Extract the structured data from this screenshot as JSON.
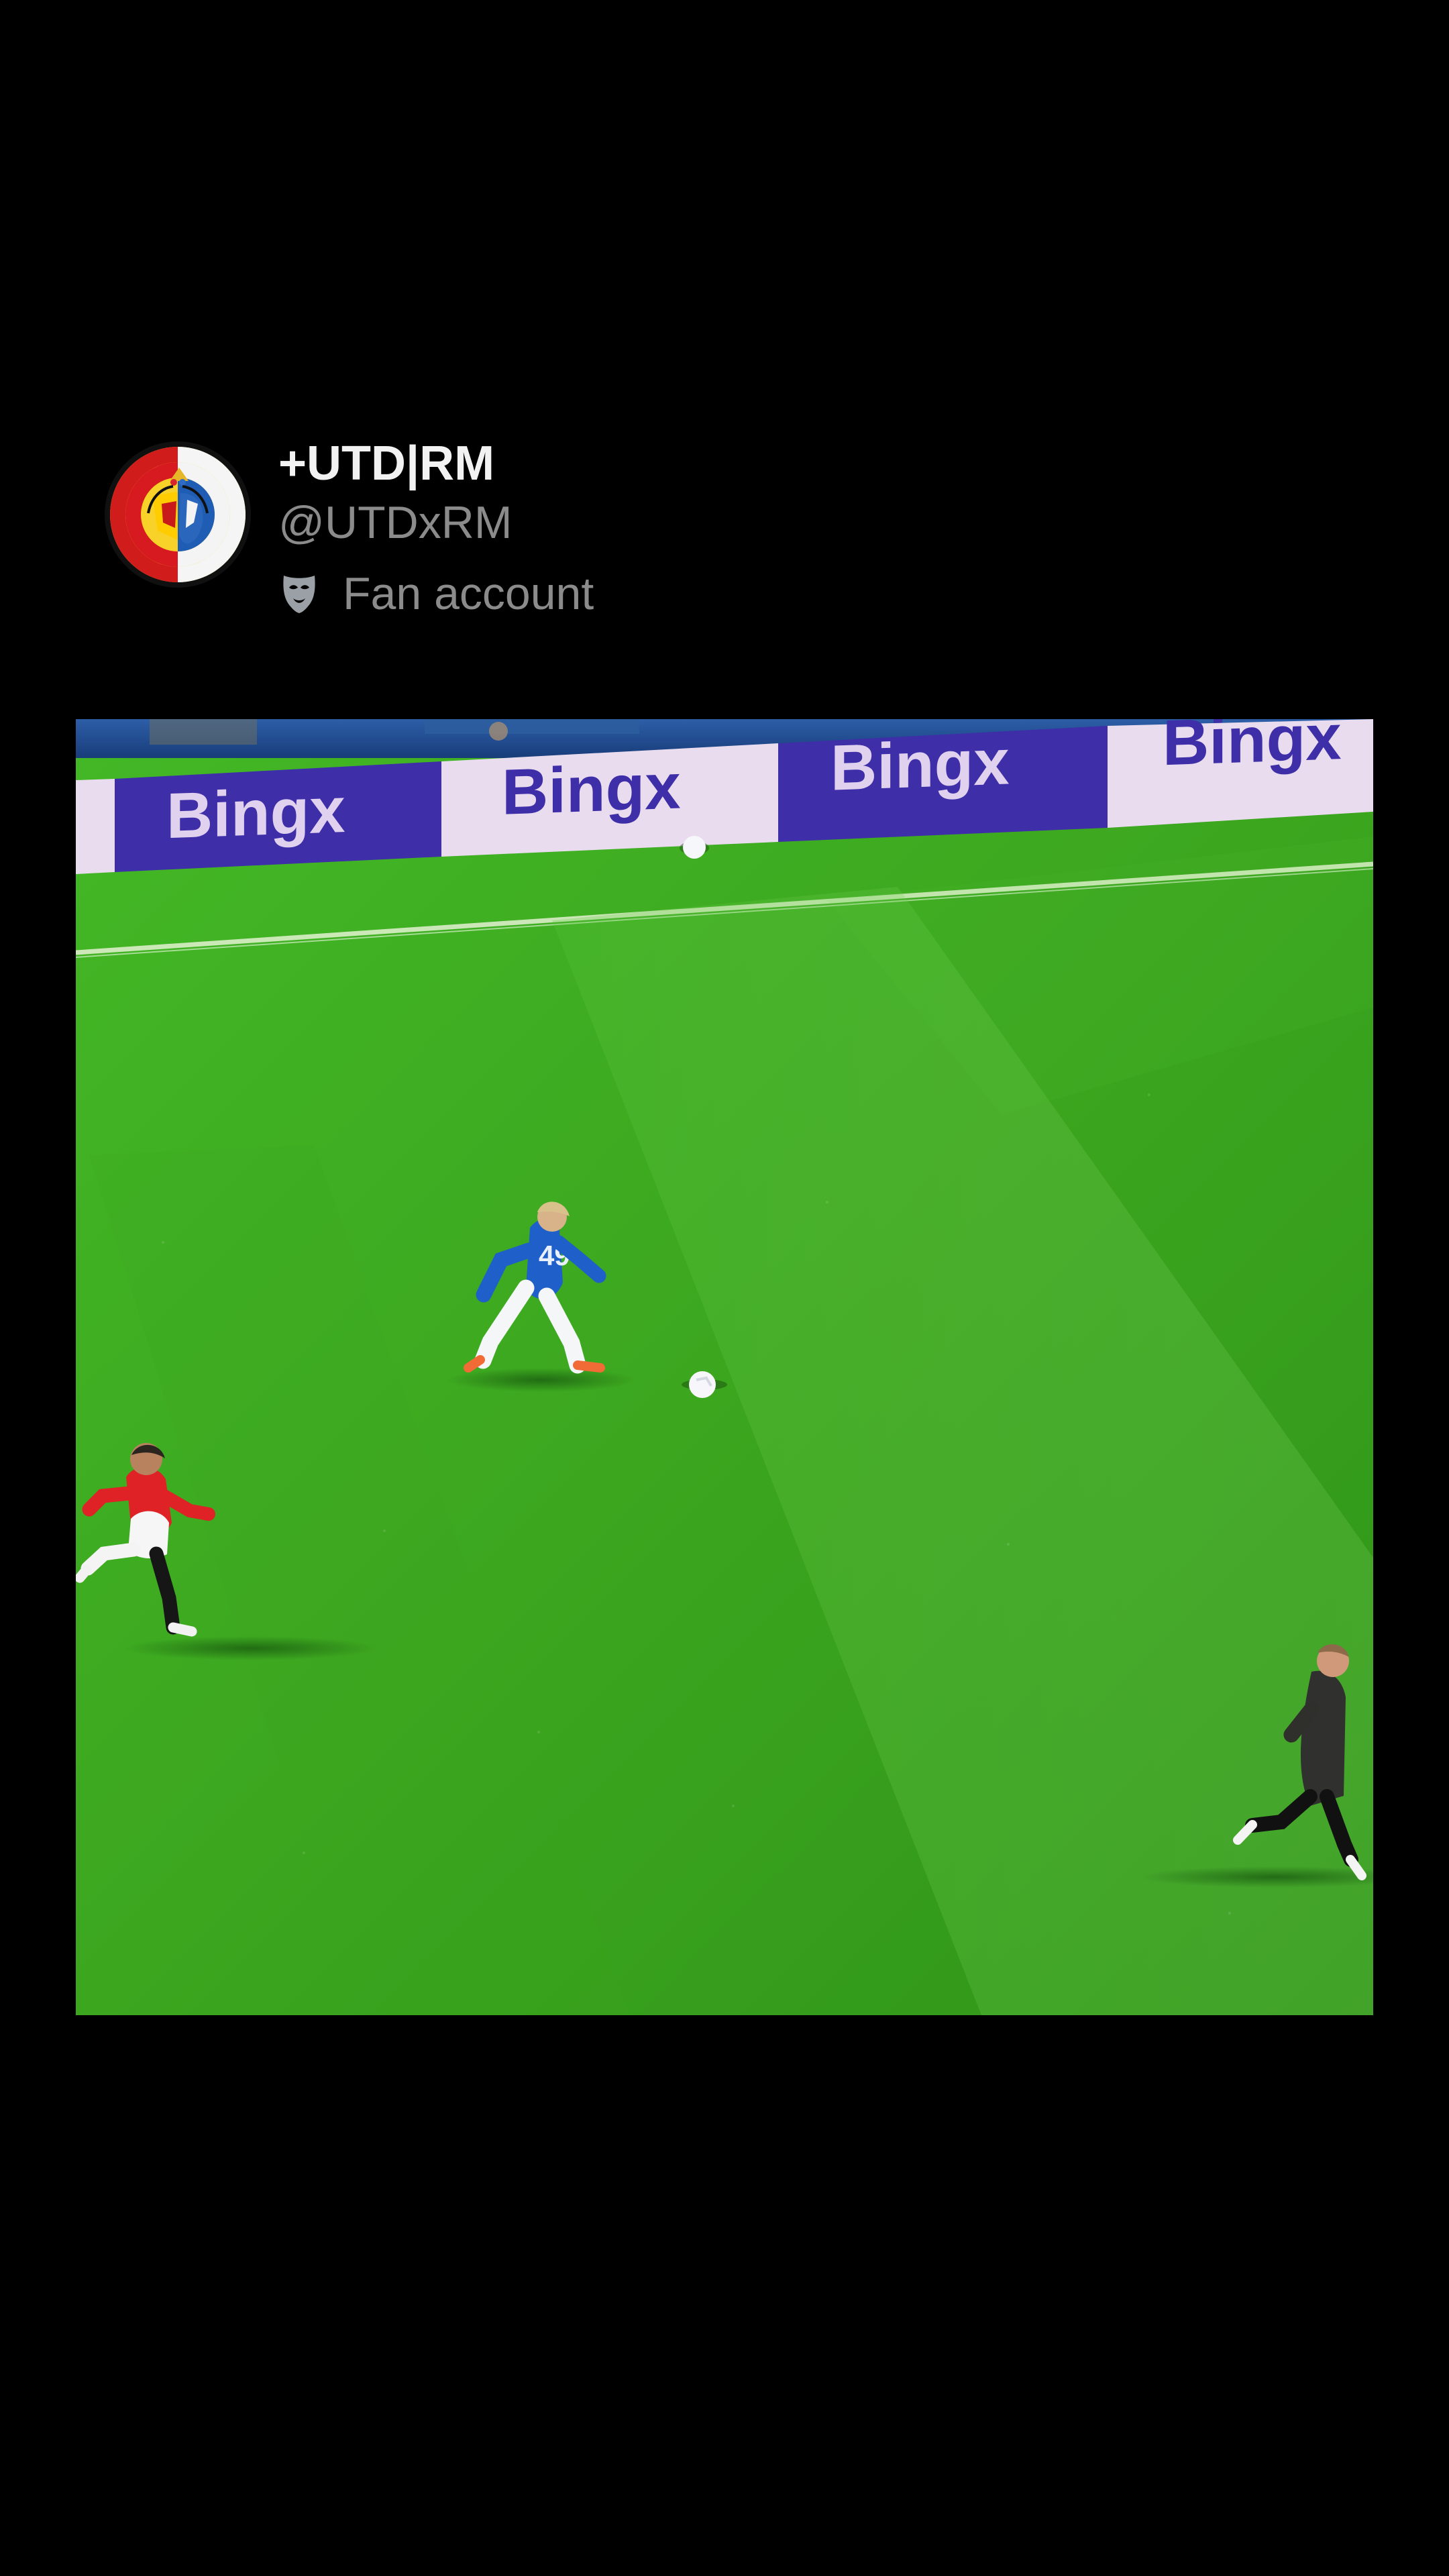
{
  "profile": {
    "display_name": "+UTD|RM",
    "handle": "@UTDxRM",
    "badge_icon": "mask-icon",
    "badge_label": "Fan account",
    "avatar_icon": "club-crest-avatar"
  },
  "media": {
    "type": "video-still",
    "board_texts": [
      "Bingx",
      "Bingx",
      "Bingx",
      "Bingx"
    ],
    "shirt_number": "49"
  },
  "colors": {
    "background": "#000000",
    "name_text": "#f2f2f2",
    "secondary_text": "#8b8b8b",
    "pitch": "#3ea81d",
    "board_purple": "#3e2ea8",
    "board_pink": "#eadcef"
  }
}
